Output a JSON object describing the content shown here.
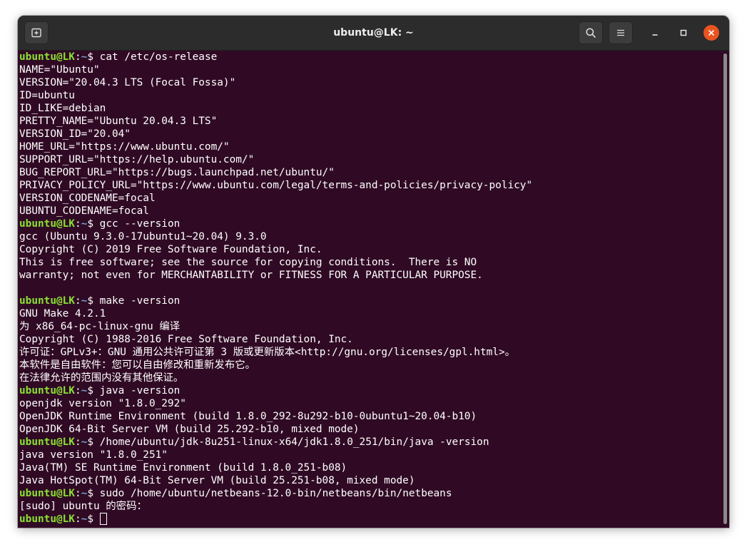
{
  "window": {
    "title": "ubuntu@LK: ~"
  },
  "titlebar": {
    "new_tab_icon": "new-tab-icon",
    "search_icon": "search-icon",
    "menu_icon": "hamburger-menu-icon",
    "minimize_icon": "minimize-icon",
    "maximize_icon": "maximize-icon",
    "close_icon": "close-icon"
  },
  "colors": {
    "terminal_bg": "#300a24",
    "prompt_user": "#8ae234",
    "prompt_path": "#729fcf",
    "close_button": "#e95420"
  },
  "prompt": {
    "user_host": "ubuntu@LK",
    "sep": ":",
    "path": "~",
    "symbol": "$"
  },
  "terminal": {
    "lines": [
      {
        "type": "prompt",
        "cmd": "cat /etc/os-release"
      },
      {
        "type": "out",
        "text": "NAME=\"Ubuntu\""
      },
      {
        "type": "out",
        "text": "VERSION=\"20.04.3 LTS (Focal Fossa)\""
      },
      {
        "type": "out",
        "text": "ID=ubuntu"
      },
      {
        "type": "out",
        "text": "ID_LIKE=debian"
      },
      {
        "type": "out",
        "text": "PRETTY_NAME=\"Ubuntu 20.04.3 LTS\""
      },
      {
        "type": "out",
        "text": "VERSION_ID=\"20.04\""
      },
      {
        "type": "out",
        "text": "HOME_URL=\"https://www.ubuntu.com/\""
      },
      {
        "type": "out",
        "text": "SUPPORT_URL=\"https://help.ubuntu.com/\""
      },
      {
        "type": "out",
        "text": "BUG_REPORT_URL=\"https://bugs.launchpad.net/ubuntu/\""
      },
      {
        "type": "out",
        "text": "PRIVACY_POLICY_URL=\"https://www.ubuntu.com/legal/terms-and-policies/privacy-policy\""
      },
      {
        "type": "out",
        "text": "VERSION_CODENAME=focal"
      },
      {
        "type": "out",
        "text": "UBUNTU_CODENAME=focal"
      },
      {
        "type": "prompt",
        "cmd": "gcc --version"
      },
      {
        "type": "out",
        "text": "gcc (Ubuntu 9.3.0-17ubuntu1~20.04) 9.3.0"
      },
      {
        "type": "out",
        "text": "Copyright (C) 2019 Free Software Foundation, Inc."
      },
      {
        "type": "out",
        "text": "This is free software; see the source for copying conditions.  There is NO"
      },
      {
        "type": "out",
        "text": "warranty; not even for MERCHANTABILITY or FITNESS FOR A PARTICULAR PURPOSE."
      },
      {
        "type": "out",
        "text": ""
      },
      {
        "type": "prompt",
        "cmd": "make -version"
      },
      {
        "type": "out",
        "text": "GNU Make 4.2.1"
      },
      {
        "type": "out",
        "text": "为 x86_64-pc-linux-gnu 编译"
      },
      {
        "type": "out",
        "text": "Copyright (C) 1988-2016 Free Software Foundation, Inc."
      },
      {
        "type": "out",
        "text": "许可证：GPLv3+：GNU 通用公共许可证第 3 版或更新版本<http://gnu.org/licenses/gpl.html>。"
      },
      {
        "type": "out",
        "text": "本软件是自由软件：您可以自由修改和重新发布它。"
      },
      {
        "type": "out",
        "text": "在法律允许的范围内没有其他保证。"
      },
      {
        "type": "prompt",
        "cmd": "java -version"
      },
      {
        "type": "out",
        "text": "openjdk version \"1.8.0_292\""
      },
      {
        "type": "out",
        "text": "OpenJDK Runtime Environment (build 1.8.0_292-8u292-b10-0ubuntu1~20.04-b10)"
      },
      {
        "type": "out",
        "text": "OpenJDK 64-Bit Server VM (build 25.292-b10, mixed mode)"
      },
      {
        "type": "prompt",
        "cmd": "/home/ubuntu/jdk-8u251-linux-x64/jdk1.8.0_251/bin/java -version"
      },
      {
        "type": "out",
        "text": "java version \"1.8.0_251\""
      },
      {
        "type": "out",
        "text": "Java(TM) SE Runtime Environment (build 1.8.0_251-b08)"
      },
      {
        "type": "out",
        "text": "Java HotSpot(TM) 64-Bit Server VM (build 25.251-b08, mixed mode)"
      },
      {
        "type": "prompt",
        "cmd": "sudo /home/ubuntu/netbeans-12.0-bin/netbeans/bin/netbeans"
      },
      {
        "type": "out",
        "text": "[sudo] ubuntu 的密码："
      },
      {
        "type": "prompt",
        "cmd": "",
        "cursor": true
      }
    ]
  }
}
